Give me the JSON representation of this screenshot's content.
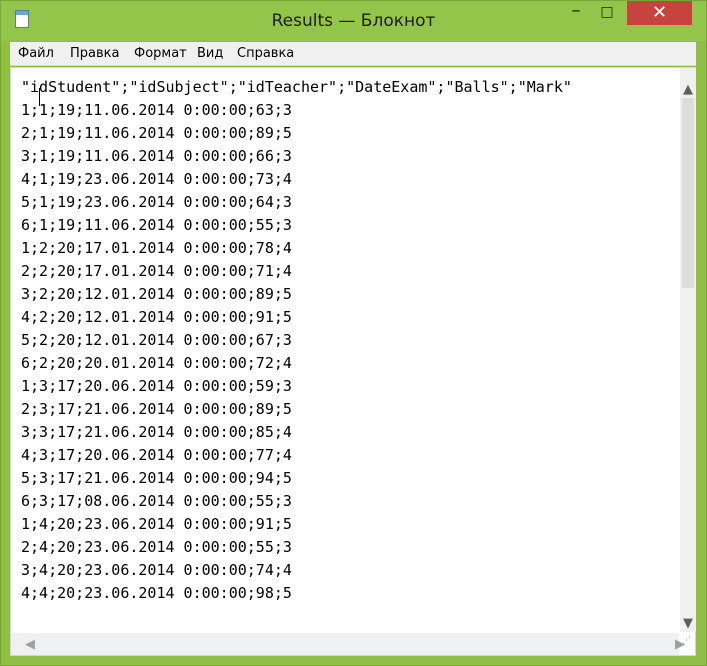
{
  "window": {
    "title": "Results — Блокнот",
    "minimize_glyph": "–",
    "maximize_glyph": "□",
    "close_glyph": "✕"
  },
  "menu": [
    "Файл",
    "Правка",
    "Формат",
    "Вид",
    "Справка"
  ],
  "editor": {
    "lines": [
      "\"idStudent\";\"idSubject\";\"idTeacher\";\"DateExam\";\"Balls\";\"Mark\"",
      "1;1;19;11.06.2014 0:00:00;63;3",
      "2;1;19;11.06.2014 0:00:00;89;5",
      "3;1;19;11.06.2014 0:00:00;66;3",
      "4;1;19;23.06.2014 0:00:00;73;4",
      "5;1;19;23.06.2014 0:00:00;64;3",
      "6;1;19;11.06.2014 0:00:00;55;3",
      "1;2;20;17.01.2014 0:00:00;78;4",
      "2;2;20;17.01.2014 0:00:00;71;4",
      "3;2;20;12.01.2014 0:00:00;89;5",
      "4;2;20;12.01.2014 0:00:00;91;5",
      "5;2;20;12.01.2014 0:00:00;67;3",
      "6;2;20;20.01.2014 0:00:00;72;4",
      "1;3;17;20.06.2014 0:00:00;59;3",
      "2;3;17;21.06.2014 0:00:00;89;5",
      "3;3;17;21.06.2014 0:00:00;85;4",
      "4;3;17;20.06.2014 0:00:00;77;4",
      "5;3;17;21.06.2014 0:00:00;94;5",
      "6;3;17;08.06.2014 0:00:00;55;3",
      "1;4;20;23.06.2014 0:00:00;91;5",
      "2;4;20;23.06.2014 0:00:00;55;3",
      "3;4;20;23.06.2014 0:00:00;74;4",
      "4;4;20;23.06.2014 0:00:00;98;5"
    ]
  },
  "icons": {
    "app": "notepad-icon",
    "scroll_up": "▲",
    "scroll_down": "▼",
    "scroll_left": "◀",
    "scroll_right": "▶",
    "grip": "⋰"
  },
  "colors": {
    "titlebar": "#93c54b",
    "close_button": "#c7443e"
  }
}
